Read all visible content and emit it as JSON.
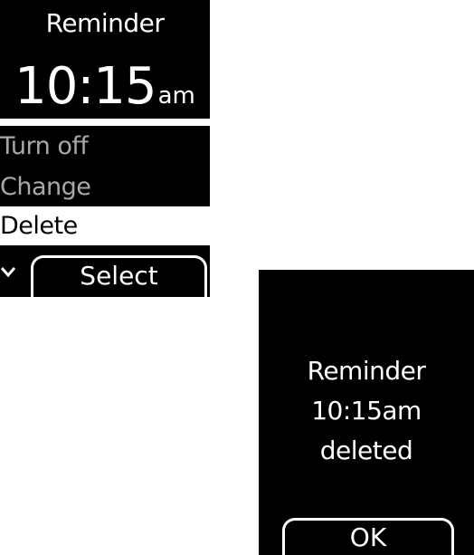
{
  "menu_screen": {
    "title": "Reminder",
    "time": "10:15",
    "meridiem": "am",
    "items": [
      {
        "label": "Turn off"
      },
      {
        "label": "Change"
      },
      {
        "label": "Delete"
      }
    ],
    "selected_item": "Delete",
    "softkey_label": "Select",
    "scroll_icon": "chevron-down-icon"
  },
  "confirm_screen": {
    "lines": [
      "Reminder",
      "10:15am",
      "deleted"
    ],
    "ok_label": "OK"
  },
  "colors": {
    "background": "#000000",
    "foreground": "#ffffff",
    "dimmed_text": "#a8a8a8",
    "highlight_bg": "#ffffff",
    "highlight_text": "#000000"
  }
}
